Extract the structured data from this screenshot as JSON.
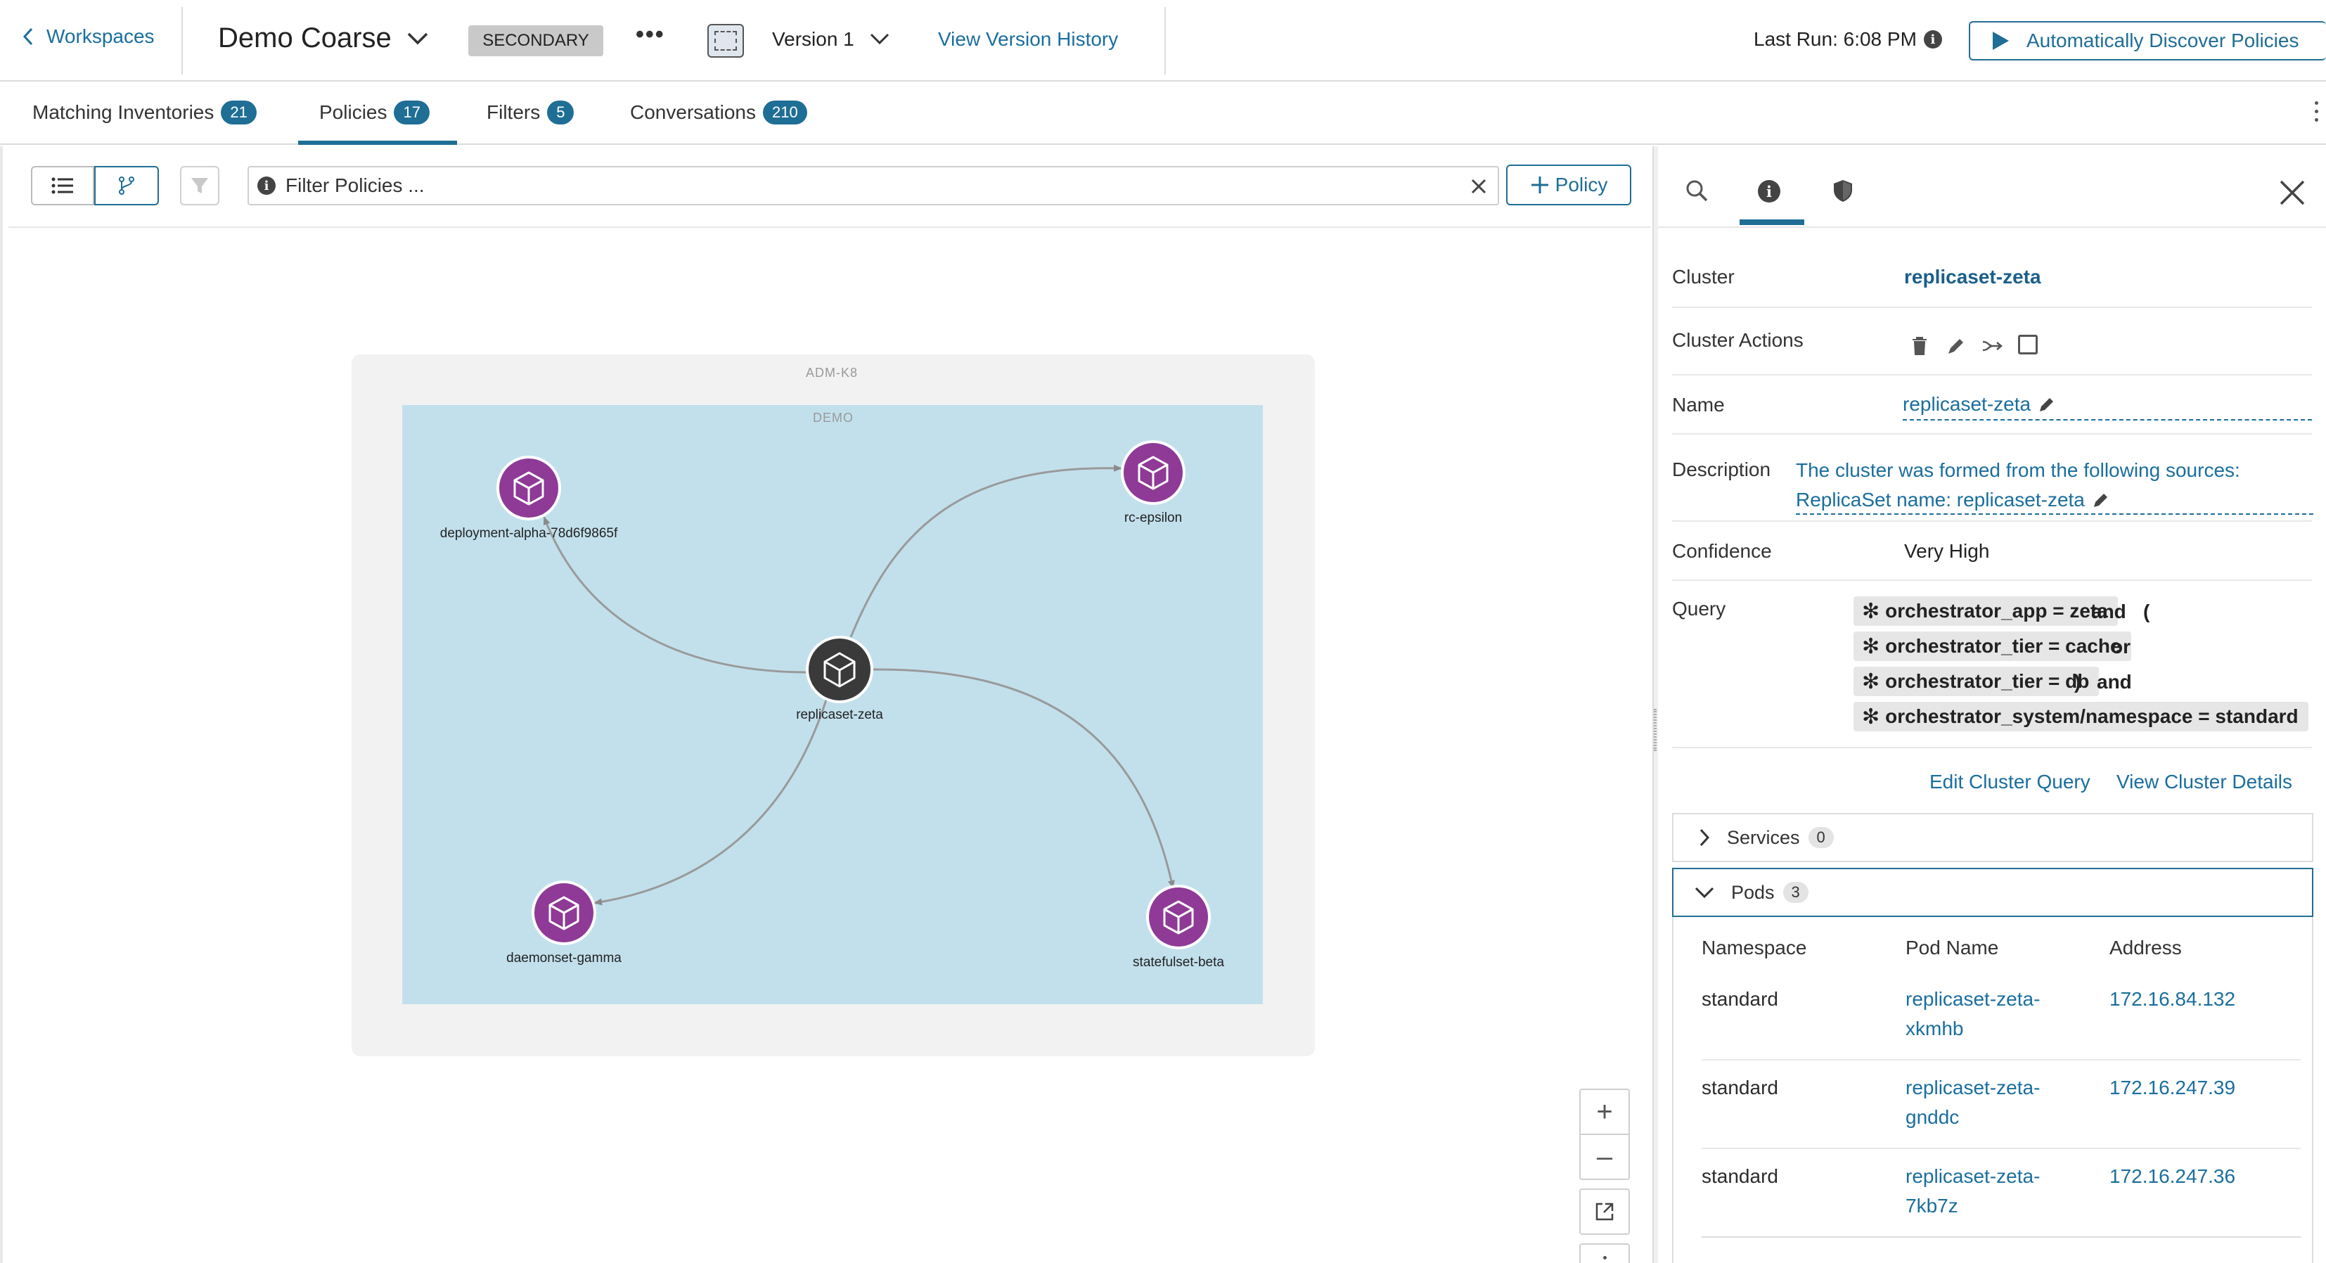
{
  "header": {
    "back_label": "Workspaces",
    "workspace_name": "Demo Coarse",
    "secondary_badge": "SECONDARY",
    "more_label": "•••",
    "version_label": "Version 1",
    "view_history_label": "View Version History",
    "last_run": "Last Run: 6:08 PM",
    "discover_label": "Automatically Discover Policies"
  },
  "tabs": [
    {
      "label": "Matching Inventories",
      "count": "21"
    },
    {
      "label": "Policies",
      "count": "17",
      "active": true
    },
    {
      "label": "Filters",
      "count": "5"
    },
    {
      "label": "Conversations",
      "count": "210"
    }
  ],
  "toolbar": {
    "filter_placeholder": "Filter Policies ...",
    "policy_button": "Policy"
  },
  "graph": {
    "outer_label": "ADM-K8",
    "inner_label": "DEMO",
    "nodes": [
      {
        "id": "deployment-alpha",
        "label": "deployment-alpha-78d6f9865f"
      },
      {
        "id": "rc-epsilon",
        "label": "rc-epsilon"
      },
      {
        "id": "replicaset-zeta",
        "label": "replicaset-zeta"
      },
      {
        "id": "daemonset-gamma",
        "label": "daemonset-gamma"
      },
      {
        "id": "statefulset-beta",
        "label": "statefulset-beta"
      }
    ],
    "zoom_in": "+",
    "zoom_out": "–"
  },
  "panel": {
    "cluster_label": "Cluster",
    "cluster_value": "replicaset-zeta",
    "actions_label": "Cluster Actions",
    "name_label": "Name",
    "name_value": "replicaset-zeta",
    "description_label": "Description",
    "description_line1": "The cluster was formed from the following sources:",
    "description_line2": "ReplicaSet name: replicaset-zeta",
    "confidence_label": "Confidence",
    "confidence_value": "Very High",
    "query_label": "Query",
    "query": {
      "chip1": "orchestrator_app = zeta",
      "op1a": "and",
      "op1b": "(",
      "chip2": "orchestrator_tier = cache",
      "op2": "or",
      "chip3": "orchestrator_tier = db",
      "op3a": ")",
      "op3b": "and",
      "chip4": "orchestrator_system/namespace = standard"
    },
    "edit_query": "Edit Cluster Query",
    "view_details": "View Cluster Details",
    "services_label": "Services",
    "services_count": "0",
    "pods_label": "Pods",
    "pods_count": "3",
    "pods_headers": [
      "Namespace",
      "Pod Name",
      "Address"
    ],
    "pods": [
      {
        "namespace": "standard",
        "name1": "replicaset-zeta-",
        "name2": "xkmhb",
        "address": "172.16.84.132"
      },
      {
        "namespace": "standard",
        "name1": "replicaset-zeta-",
        "name2": "gnddc",
        "address": "172.16.247.39"
      },
      {
        "namespace": "standard",
        "name1": "replicaset-zeta-",
        "name2": "7kb7z",
        "address": "172.16.247.36"
      }
    ]
  },
  "colors": {
    "accent": "#1f6e95",
    "link": "#1a6e9e",
    "node": "#8e3a96",
    "center_node": "#3a3a3a",
    "cluster_bg": "#c2e0ec"
  }
}
